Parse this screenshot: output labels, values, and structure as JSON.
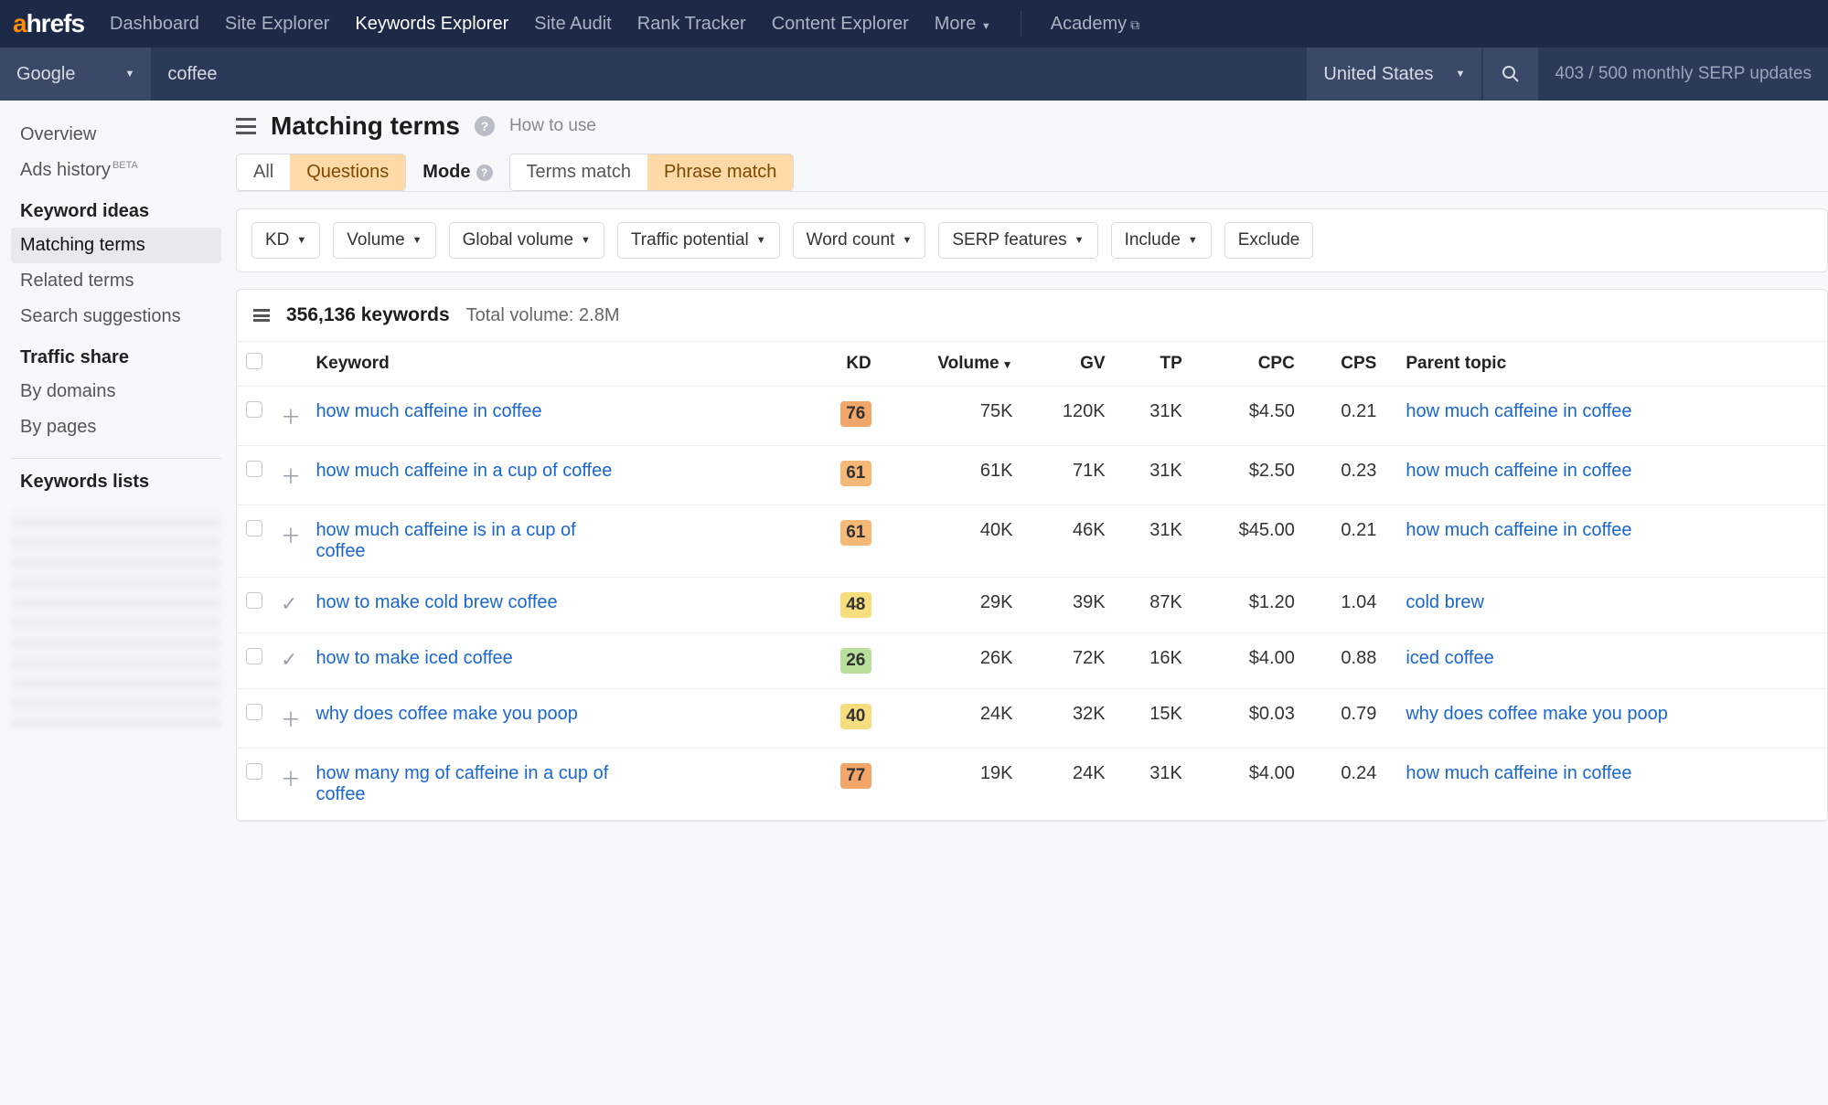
{
  "nav": {
    "logo_a": "a",
    "logo_rest": "hrefs",
    "items": [
      "Dashboard",
      "Site Explorer",
      "Keywords Explorer",
      "Site Audit",
      "Rank Tracker",
      "Content Explorer",
      "More"
    ],
    "active_index": 2,
    "academy": "Academy"
  },
  "search": {
    "engine": "Google",
    "query": "coffee",
    "country": "United States",
    "status": "403 / 500 monthly SERP updates"
  },
  "sidebar": {
    "overview": "Overview",
    "ads_history": "Ads history",
    "beta": "BETA",
    "ideas_heading": "Keyword ideas",
    "ideas": [
      "Matching terms",
      "Related terms",
      "Search suggestions"
    ],
    "ideas_active": 0,
    "traffic_heading": "Traffic share",
    "traffic": [
      "By domains",
      "By pages"
    ],
    "lists_heading": "Keywords lists"
  },
  "page": {
    "title": "Matching terms",
    "how_to": "How to use",
    "seg1": [
      "All",
      "Questions"
    ],
    "seg1_active": 1,
    "mode_label": "Mode",
    "seg2": [
      "Terms match",
      "Phrase match"
    ],
    "seg2_active": 1
  },
  "filters": [
    "KD",
    "Volume",
    "Global volume",
    "Traffic potential",
    "Word count",
    "SERP features",
    "Include",
    "Exclude"
  ],
  "results": {
    "count_label": "356,136 keywords",
    "total_volume": "Total volume: 2.8M",
    "columns": [
      "Keyword",
      "KD",
      "Volume",
      "GV",
      "TP",
      "CPC",
      "CPS",
      "Parent topic"
    ],
    "rows": [
      {
        "icon": "plus",
        "keyword": "how much caffeine in coffee",
        "kd": 76,
        "kd_color": "#f2a66a",
        "volume": "75K",
        "gv": "120K",
        "tp": "31K",
        "cpc": "$4.50",
        "cps": "0.21",
        "parent": "how much caffeine in coffee"
      },
      {
        "icon": "plus",
        "keyword": "how much caffeine in a cup of coffee",
        "kd": 61,
        "kd_color": "#f6b877",
        "volume": "61K",
        "gv": "71K",
        "tp": "31K",
        "cpc": "$2.50",
        "cps": "0.23",
        "parent": "how much caffeine in coffee"
      },
      {
        "icon": "plus",
        "keyword": "how much caffeine is in a cup of coffee",
        "kd": 61,
        "kd_color": "#f6b877",
        "volume": "40K",
        "gv": "46K",
        "tp": "31K",
        "cpc": "$45.00",
        "cps": "0.21",
        "parent": "how much caffeine in coffee"
      },
      {
        "icon": "check",
        "keyword": "how to make cold brew coffee",
        "kd": 48,
        "kd_color": "#f6de7e",
        "volume": "29K",
        "gv": "39K",
        "tp": "87K",
        "cpc": "$1.20",
        "cps": "1.04",
        "parent": "cold brew"
      },
      {
        "icon": "check",
        "keyword": "how to make iced coffee",
        "kd": 26,
        "kd_color": "#b9df9c",
        "volume": "26K",
        "gv": "72K",
        "tp": "16K",
        "cpc": "$4.00",
        "cps": "0.88",
        "parent": "iced coffee"
      },
      {
        "icon": "plus",
        "keyword": "why does coffee make you poop",
        "kd": 40,
        "kd_color": "#f6de7e",
        "volume": "24K",
        "gv": "32K",
        "tp": "15K",
        "cpc": "$0.03",
        "cps": "0.79",
        "parent": "why does coffee make you poop"
      },
      {
        "icon": "plus",
        "keyword": "how many mg of caffeine in a cup of coffee",
        "kd": 77,
        "kd_color": "#f2a66a",
        "volume": "19K",
        "gv": "24K",
        "tp": "31K",
        "cpc": "$4.00",
        "cps": "0.24",
        "parent": "how much caffeine in coffee"
      }
    ]
  }
}
